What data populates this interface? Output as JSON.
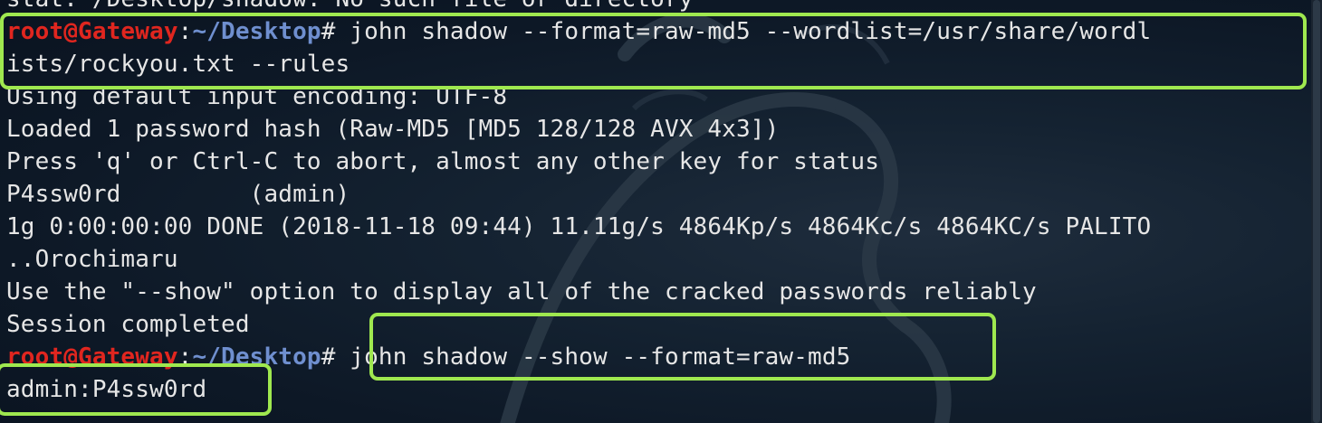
{
  "terminal": {
    "lines": [
      {
        "text": "stat: /Desktop/shadow: No such file or directory"
      },
      {
        "prompt": {
          "user": "root@Gateway",
          "sep": ":",
          "path": "~/Desktop",
          "symbol": "#"
        },
        "text": " john shadow --format=raw-md5 --wordlist=/usr/share/wordl"
      },
      {
        "text": "ists/rockyou.txt --rules"
      },
      {
        "text": "Using default input encoding: UTF-8"
      },
      {
        "text": "Loaded 1 password hash (Raw-MD5 [MD5 128/128 AVX 4x3])"
      },
      {
        "text": "Press 'q' or Ctrl-C to abort, almost any other key for status"
      },
      {
        "text": "P4ssw0rd         (admin)"
      },
      {
        "text": "1g 0:00:00:00 DONE (2018-11-18 09:44) 11.11g/s 4864Kp/s 4864Kc/s 4864KC/s PALITO"
      },
      {
        "text": "..Orochimaru"
      },
      {
        "text": "Use the \"--show\" option to display all of the cracked passwords reliably"
      },
      {
        "text": "Session completed"
      },
      {
        "prompt": {
          "user": "root@Gateway",
          "sep": ":",
          "path": "~/Desktop",
          "symbol": "#"
        },
        "text": " john shadow --show --format=raw-md5"
      },
      {
        "text": "admin:P4ssw0rd"
      }
    ]
  },
  "colors": {
    "background": "#0b1320",
    "text": "#e6e6e6",
    "prompt_user": "#e0261f",
    "prompt_path": "#6f8fcf",
    "highlight_box": "#9fe84f"
  },
  "icons": {
    "watermark": "kali-dragon-icon"
  }
}
